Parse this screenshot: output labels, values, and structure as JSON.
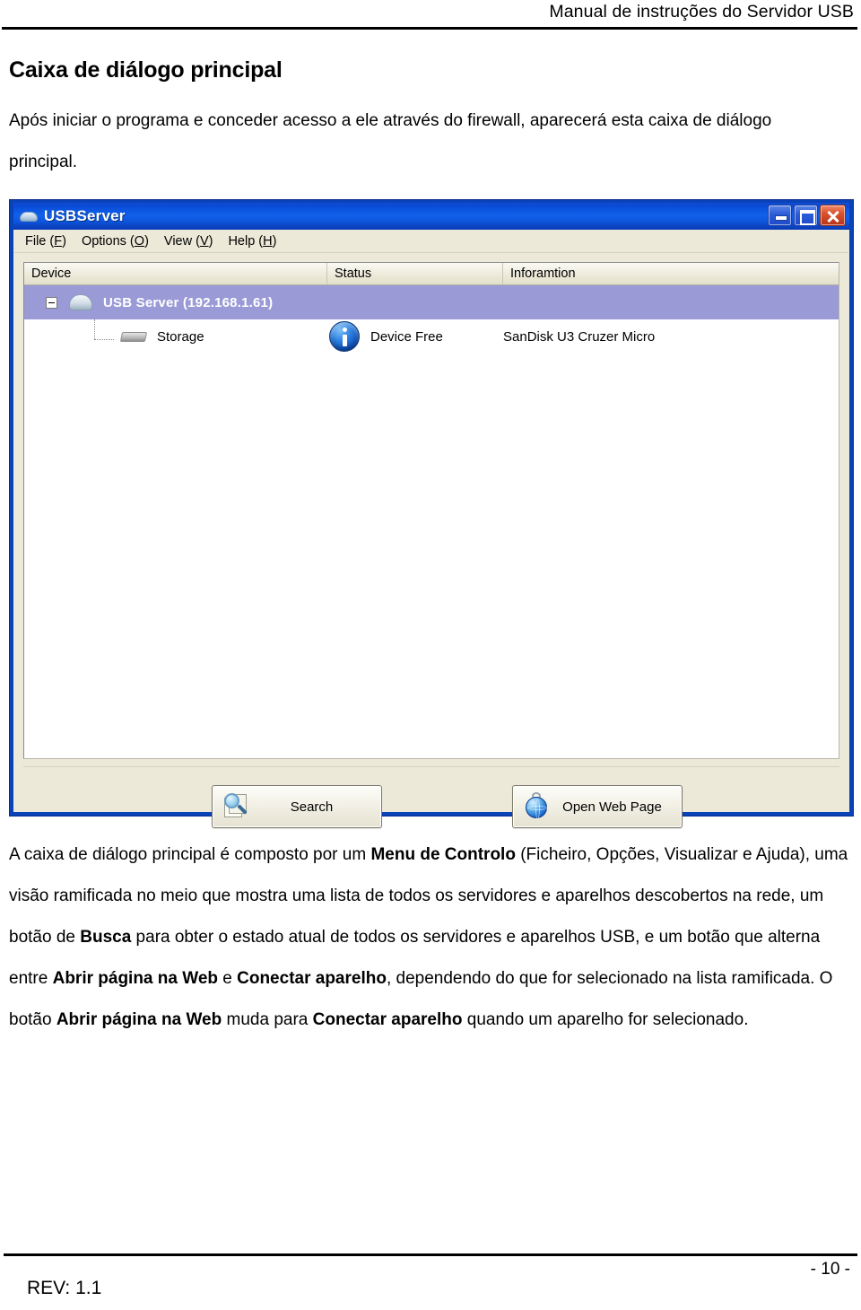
{
  "document": {
    "running_header": "Manual de instruções do Servidor USB",
    "heading": "Caixa de diálogo principal",
    "intro": "Após iniciar o programa e conceder acesso a ele através do firewall, aparecerá esta caixa de diálogo principal.",
    "footer": {
      "page_number": "- 10 -",
      "revision": "REV: 1.1"
    }
  },
  "app_window": {
    "title": "USBServer",
    "title_icon": "server-dome-icon",
    "window_controls": {
      "minimize": "minimize-button",
      "maximize": "maximize-button",
      "close": "close-button"
    },
    "menu": [
      {
        "label": "File (F)",
        "text": "File (",
        "mnemonic": "F",
        "tail": ")"
      },
      {
        "label": "Options (O)",
        "text": "Options (",
        "mnemonic": "O",
        "tail": ")"
      },
      {
        "label": "View (V)",
        "text": "View (",
        "mnemonic": "V",
        "tail": ")"
      },
      {
        "label": "Help (H)",
        "text": "Help (",
        "mnemonic": "H",
        "tail": ")"
      }
    ],
    "columns": [
      "Device",
      "Status",
      "Inforamtion"
    ],
    "rows": [
      {
        "device": "USB Server  (192.168.1.61)",
        "status": "",
        "information": "",
        "selected": true,
        "icon": "server-icon",
        "level": 0
      },
      {
        "device": "Storage",
        "status": "Device Free",
        "information": "SanDisk U3 Cruzer Micro",
        "selected": false,
        "icon": "storage-icon",
        "status_icon": "info-icon",
        "level": 1
      }
    ],
    "buttons": {
      "search": "Search",
      "open_web_page": "Open Web Page"
    },
    "colors": {
      "titlebar_blue": "#0c57e2",
      "window_chrome": "#ece9d8",
      "selection": "#9a9ad6",
      "close_button": "#d8522c"
    }
  },
  "paragraphs": {
    "p1_a": "A caixa de diálogo principal é composto por um ",
    "p1_b": "Menu de Controlo",
    "p1_c": " (Ficheiro, Opções, Visualizar e Ajuda), uma visão ramificada no meio que mostra uma lista de todos os servidores e aparelhos descobertos na rede, um botão de ",
    "p1_d": "Busca",
    "p1_e": " para obter o estado atual de todos os servidores e aparelhos USB, e um botão que alterna entre ",
    "p1_f": "Abrir página na Web",
    "p1_g": " e ",
    "p1_h": "Conectar aparelho",
    "p1_i": ", dependendo do que for selecionado na lista ramificada. O botão ",
    "p1_j": "Abrir página na Web",
    "p1_k": " muda para ",
    "p1_l": "Conectar aparelho",
    "p1_m": " quando um aparelho for selecionado."
  }
}
